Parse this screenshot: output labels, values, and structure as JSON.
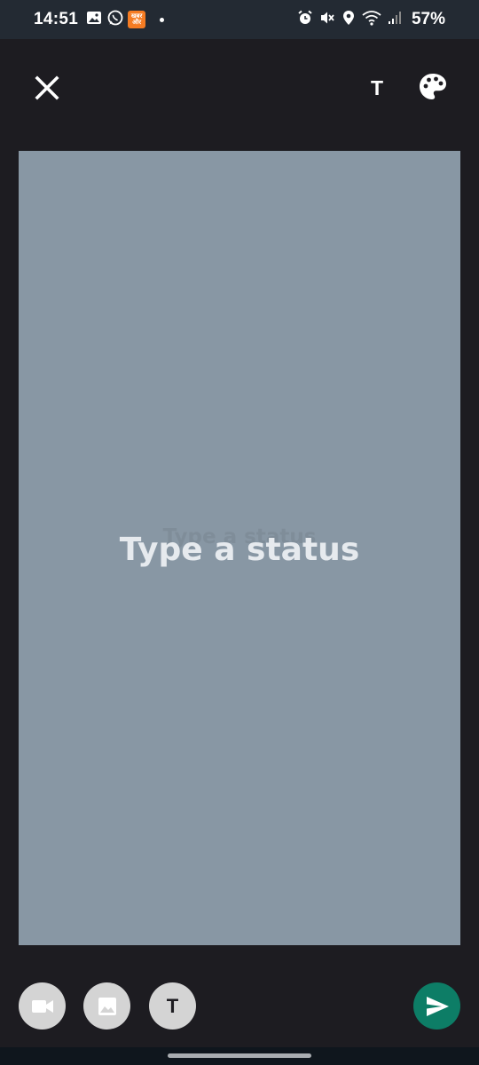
{
  "status_bar": {
    "time": "14:51",
    "notification_badge_text": "खबर\nऔर",
    "battery": "57%"
  },
  "top_bar": {
    "text_tool_label": "T"
  },
  "composer": {
    "background_color": "#8897a4",
    "placeholder": "Type a status",
    "ghost_text": "Type a status"
  },
  "bottom_bar": {
    "text_button_label": "T",
    "send_color": "#0d7d66"
  },
  "icons": {
    "close": "close-icon",
    "palette": "palette-icon",
    "video": "video-icon",
    "gallery": "gallery-icon",
    "send": "send-icon"
  }
}
